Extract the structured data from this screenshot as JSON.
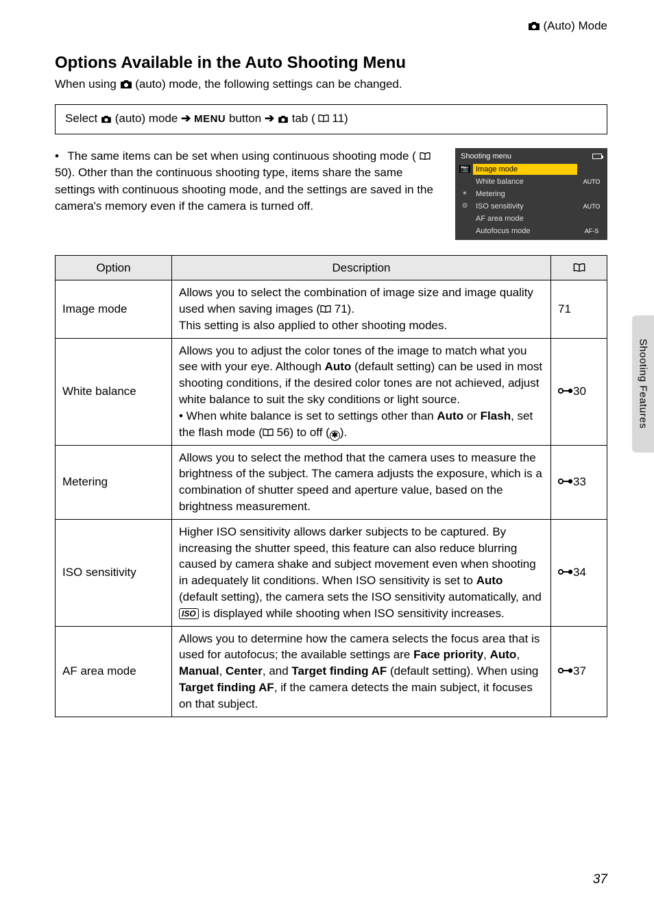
{
  "header": {
    "mode_label": "(Auto) Mode"
  },
  "title": "Options Available in the Auto Shooting Menu",
  "intro_before_icon": "When using ",
  "intro_after_icon": " (auto) mode, the following settings can be changed.",
  "nav": {
    "select": "Select ",
    "auto_mode": " (auto) mode ",
    "menu_btn": "MENU",
    "button_word": " button ",
    "tab_word": " tab (",
    "page_ref": " 11)"
  },
  "bullet_text_1": "The same items can be set when using continuous shooting mode (",
  "bullet_ref_1": " 50). Other than the continuous shooting type, items share the same settings with continuous shooting mode, and the settings are saved in the camera's memory even if the camera is turned off.",
  "lcd": {
    "title": "Shooting menu",
    "rows": [
      {
        "label": "Image mode",
        "value": "",
        "selected": true
      },
      {
        "label": "White balance",
        "value": "AUTO"
      },
      {
        "label": "Metering",
        "value": ""
      },
      {
        "label": "ISO sensitivity",
        "value": "AUTO"
      },
      {
        "label": "AF area mode",
        "value": ""
      },
      {
        "label": "Autofocus mode",
        "value": "AF-S"
      }
    ]
  },
  "table": {
    "headers": {
      "option": "Option",
      "description": "Description",
      "ref": ""
    },
    "rows": [
      {
        "option": "Image mode",
        "desc_parts": [
          {
            "t": "Allows you to select the combination of image size and image quality used when saving images ("
          },
          {
            "book": true
          },
          {
            "t": " 71).\nThis setting is also applied to other shooting modes."
          }
        ],
        "ref_type": "plain",
        "ref": "71"
      },
      {
        "option": "White balance",
        "desc_parts": [
          {
            "t": "Allows you to adjust the color tones of the image to match what you see with your eye. Although "
          },
          {
            "b": "Auto"
          },
          {
            "t": " (default setting) can be used in most shooting conditions, if the desired color tones are not achieved, adjust white balance to suit the sky conditions or light source.\n•  When white balance is set to settings other than "
          },
          {
            "b": "Auto"
          },
          {
            "t": " or "
          },
          {
            "b": "Flash"
          },
          {
            "t": ", set the flash mode ("
          },
          {
            "book": true
          },
          {
            "t": " 56) to off ("
          },
          {
            "flashoff": true
          },
          {
            "t": ")."
          }
        ],
        "ref_type": "adv",
        "ref": "30"
      },
      {
        "option": "Metering",
        "desc_parts": [
          {
            "t": "Allows you to select the method that the camera uses to measure the brightness of the subject. The camera adjusts the exposure, which is a combination of shutter speed and aperture value, based on the brightness measurement."
          }
        ],
        "ref_type": "adv",
        "ref": "33"
      },
      {
        "option": "ISO sensitivity",
        "desc_parts": [
          {
            "t": "Higher ISO sensitivity allows darker subjects to be captured. By increasing the shutter speed, this feature can also reduce blurring caused by camera shake and subject movement even when shooting in adequately lit conditions. When ISO sensitivity is set to "
          },
          {
            "b": "Auto"
          },
          {
            "t": " (default setting), the camera sets the ISO sensitivity automatically, and "
          },
          {
            "iso": true
          },
          {
            "t": " is displayed while shooting when ISO sensitivity increases."
          }
        ],
        "ref_type": "adv",
        "ref": "34"
      },
      {
        "option": "AF area mode",
        "desc_parts": [
          {
            "t": "Allows you to determine how the camera selects the focus area that is used for autofocus; the available settings are "
          },
          {
            "b": "Face priority"
          },
          {
            "t": ", "
          },
          {
            "b": "Auto"
          },
          {
            "t": ", "
          },
          {
            "b": "Manual"
          },
          {
            "t": ", "
          },
          {
            "b": "Center"
          },
          {
            "t": ", and "
          },
          {
            "b": "Target finding AF"
          },
          {
            "t": " (default setting). When using "
          },
          {
            "b": "Target finding AF"
          },
          {
            "t": ", if the camera detects the main subject, it focuses on that subject."
          }
        ],
        "ref_type": "adv",
        "ref": "37"
      }
    ]
  },
  "side_tab": "Shooting Features",
  "page_number": "37"
}
